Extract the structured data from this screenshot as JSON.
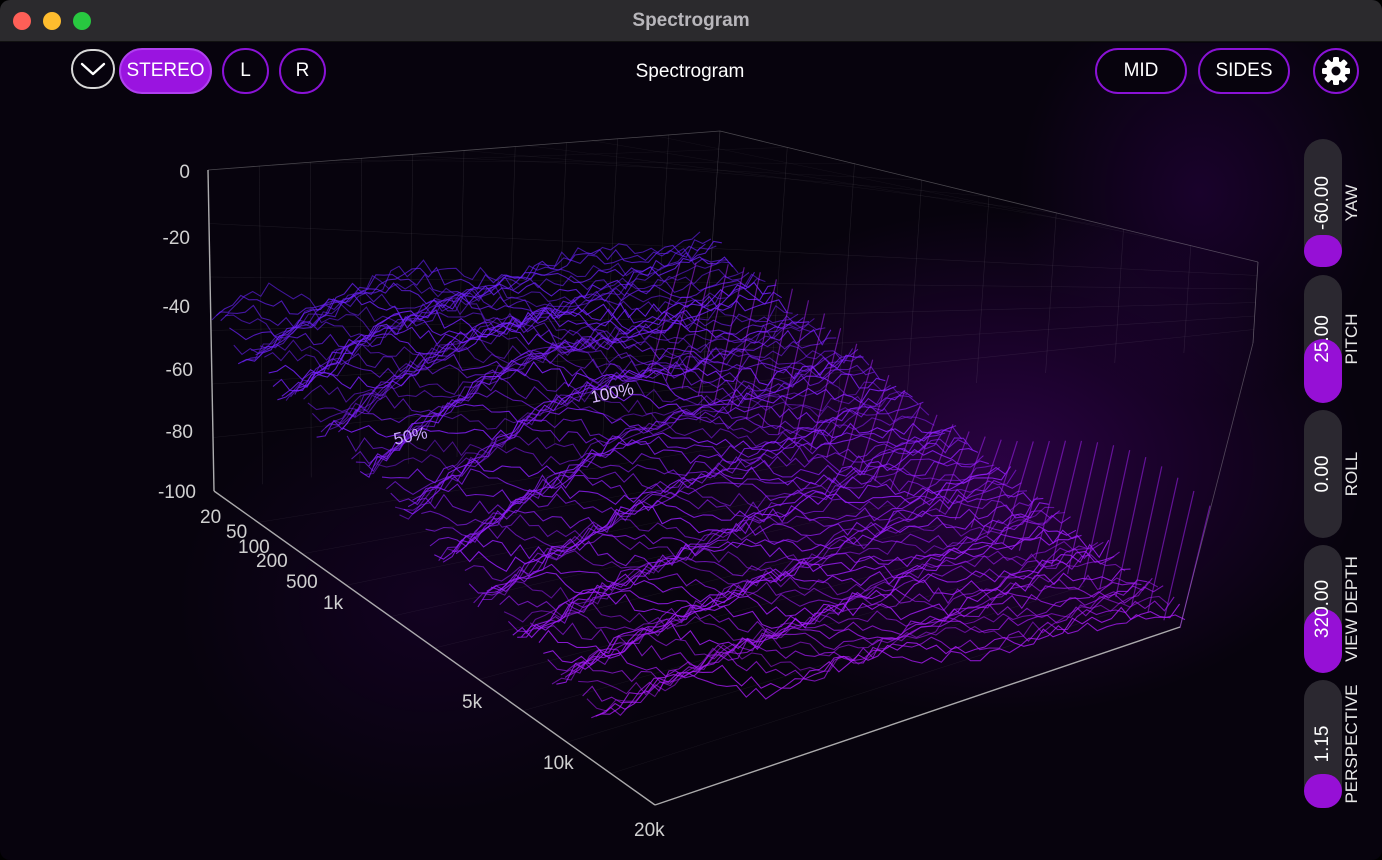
{
  "window": {
    "title": "Spectrogram"
  },
  "toolbar": {
    "channels": [
      {
        "label": "STEREO",
        "active": true
      },
      {
        "label": "L",
        "active": false
      },
      {
        "label": "R",
        "active": false
      }
    ],
    "title": "Spectrogram",
    "modes": [
      {
        "label": "MID"
      },
      {
        "label": "SIDES"
      }
    ]
  },
  "plot": {
    "z_axis_labels": [
      "0",
      "-20",
      "-40",
      "-60",
      "-80",
      "-100"
    ],
    "freq_axis_labels": [
      "20",
      "50",
      "100",
      "200",
      "500",
      "1k",
      "5k",
      "10k",
      "20k"
    ],
    "floor_labels": [
      "50%",
      "100%"
    ]
  },
  "controls": [
    {
      "label": "YAW",
      "value": "-60.00",
      "level": 0.25
    },
    {
      "label": "PITCH",
      "value": "25.00",
      "level": 0.5
    },
    {
      "label": "ROLL",
      "value": "0.00",
      "level": 0
    },
    {
      "label": "VIEW DEPTH",
      "value": "320.00",
      "level": 0.5
    },
    {
      "label": "PERSPECTIVE",
      "value": "1.15",
      "level": 0.25
    }
  ],
  "colors": {
    "accent": "#9a14e0",
    "surface_back": "#6a22ff",
    "surface_front": "#b01cff"
  }
}
